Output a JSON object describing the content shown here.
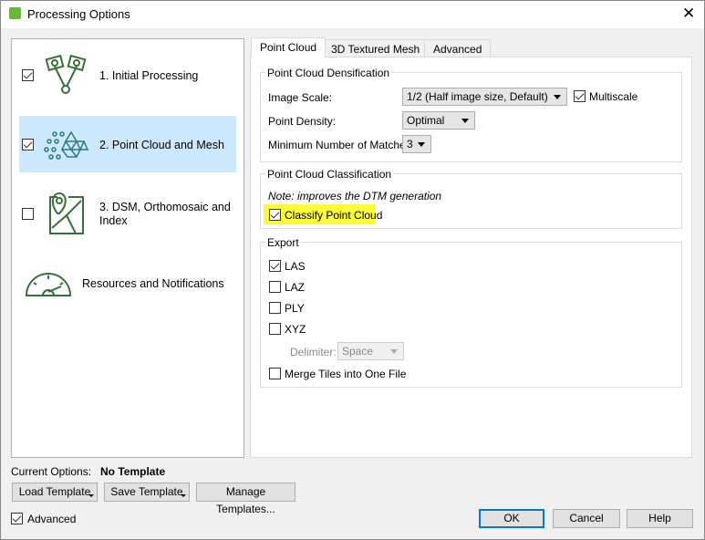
{
  "window": {
    "title": "Processing Options",
    "close": "✕"
  },
  "sidebar": {
    "items": [
      {
        "label": "1. Initial Processing",
        "checked": true,
        "icon": "camera-network-icon"
      },
      {
        "label": "2. Point Cloud and Mesh",
        "checked": true,
        "selected": true,
        "icon": "point-cloud-mesh-icon"
      },
      {
        "label": "3. DSM, Orthomosaic and Index",
        "checked": false,
        "icon": "map-pin-icon"
      },
      {
        "label": "Resources and Notifications",
        "icon": "gauge-icon"
      }
    ]
  },
  "tabs": [
    {
      "label": "Point Cloud",
      "active": true
    },
    {
      "label": "3D Textured Mesh"
    },
    {
      "label": "Advanced"
    }
  ],
  "densification": {
    "title": "Point Cloud Densification",
    "image_scale_label": "Image Scale:",
    "image_scale_value": "1/2 (Half image size, Default)",
    "multiscale_label": "Multiscale",
    "multiscale_checked": true,
    "point_density_label": "Point Density:",
    "point_density_value": "Optimal",
    "min_matches_label": "Minimum Number of Matches:",
    "min_matches_value": "3"
  },
  "classification": {
    "title": "Point Cloud Classification",
    "note": "Note: improves the DTM generation",
    "classify_label": "Classify Point Cloud",
    "classify_checked": true,
    "highlight_color": "#fbfb3c"
  },
  "export": {
    "title": "Export",
    "las": "LAS",
    "laz": "LAZ",
    "ply": "PLY",
    "xyz": "XYZ",
    "delimiter_label": "Delimiter:",
    "delimiter_value": "Space",
    "merge_label": "Merge Tiles into One File"
  },
  "footer": {
    "current_label": "Current Options:",
    "current_value": "No Template",
    "load": "Load Template",
    "save": "Save Template",
    "manage": "Manage Templates...",
    "advanced": "Advanced",
    "ok": "OK",
    "cancel": "Cancel",
    "help": "Help"
  },
  "colors": {
    "icon": "#3a6e3a",
    "selection": "#cce8ff",
    "accent": "#0078d7"
  }
}
